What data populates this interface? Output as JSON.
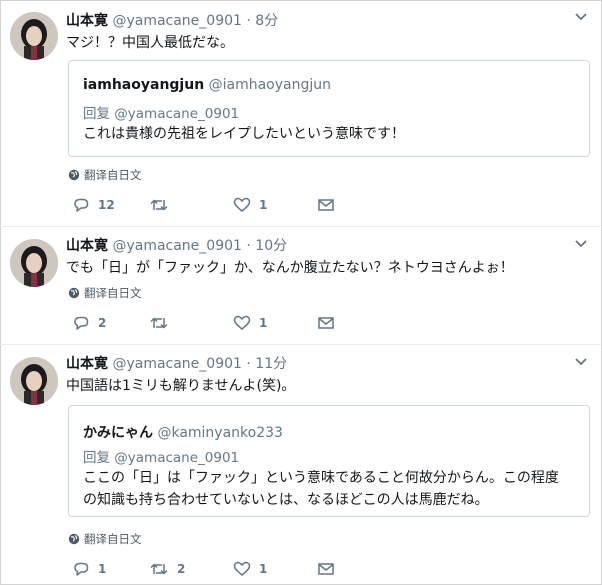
{
  "tweets": [
    {
      "author_name": "山本寛",
      "author_handle": "@yamacane_0901",
      "time": "· 8分",
      "text": "マジ！？中国人最低だな。",
      "quote": {
        "name": "iamhaoyangjun",
        "handle": "@iamhaoyangjun",
        "reply_prefix": "回复",
        "reply_to": "@yamacane_0901",
        "text_lines": [
          "これは貴様の先祖をレイプしたいという意味です！"
        ]
      },
      "translate_label": "翻译自日文",
      "reply_count": "12",
      "retweet_count": "",
      "like_count": "1"
    },
    {
      "author_name": "山本寛",
      "author_handle": "@yamacane_0901",
      "time": "· 10分",
      "text": "でも「日」が「ファック」か、なんか腹立たない？ネトウヨさんよぉ！",
      "translate_label": "翻译自日文",
      "reply_count": "2",
      "retweet_count": "",
      "like_count": "1"
    },
    {
      "author_name": "山本寛",
      "author_handle": "@yamacane_0901",
      "time": "· 11分",
      "text": "中国語は1ミリも解りませんよ(笑)。",
      "quote": {
        "name": "かみにゃん",
        "handle": "@kaminyanko233",
        "reply_prefix": "回复",
        "reply_to": "@yamacane_0901",
        "text_lines": [
          "ここの「日」は「ファック」という意味であること何故分からん。この程度",
          "の知識も持ち合わせていないとは、なるほどこの人は馬鹿だね。"
        ]
      },
      "translate_label": "翻译自日文",
      "reply_count": "1",
      "retweet_count": "2",
      "like_count": "1"
    }
  ],
  "icons": {
    "more": "chevron-down-icon",
    "translate": "globe-icon",
    "reply": "reply-icon",
    "retweet": "retweet-icon",
    "like": "heart-icon",
    "dm": "envelope-icon"
  },
  "colors": {
    "text": "#14171a",
    "secondary": "#657786",
    "border": "#ccd6dd",
    "divider": "#e6ecf0"
  }
}
